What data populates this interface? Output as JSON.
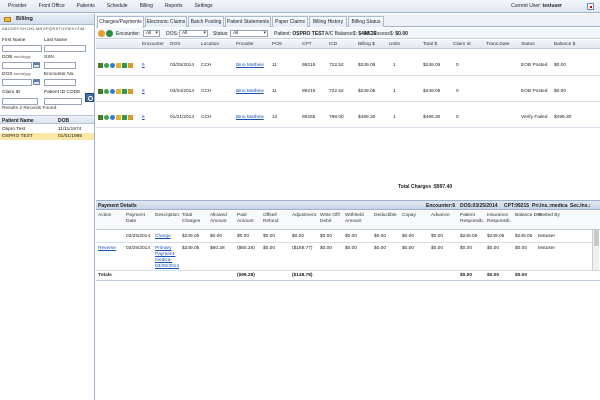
{
  "nav": {
    "items": [
      "Provider",
      "Front Office",
      "Patients",
      "Schedule",
      "Billing",
      "Reports",
      "Settings"
    ],
    "user_label": "Current User:",
    "user_name": "testuser"
  },
  "left": {
    "title": "Billing",
    "alphabet": [
      "A",
      "B",
      "C",
      "D",
      "E",
      "F",
      "G",
      "H",
      "I",
      "J",
      "K",
      "L",
      "M",
      "N",
      "O",
      "P",
      "Q",
      "R",
      "S",
      "T",
      "U",
      "V",
      "W",
      "X",
      "Y",
      "Z",
      "All"
    ],
    "first_name_label": "First Name",
    "last_name_label": "Last Name",
    "dob_label": "DOB",
    "date_hint": "mm/dd/yyyy",
    "ssn_label": "SSN",
    "dos_label": "DOS",
    "encounter_no_label": "Encounter No.",
    "claim_id_label": "Claim ID",
    "patient_id_label": "Patient ID",
    "code_label": "CODE",
    "results": "Results 2 Records Found.",
    "list_headers": [
      "Patient Name",
      "DOB"
    ],
    "patients": [
      {
        "name": "Ospro Test",
        "dob": "11/11/1974",
        "selected": false
      },
      {
        "name": "OSPRO TEST",
        "dob": "01/01/1985",
        "selected": true
      }
    ]
  },
  "tabs": [
    "Charges/Payments",
    "Electronic Claims",
    "Batch Posting",
    "Patient Statements",
    "Paper Claims",
    "Billing History",
    "Billing Status"
  ],
  "toolbar": {
    "encounter_label": "Encounter:",
    "encounter_value": "All",
    "dos_label": "DOS:",
    "dos_value": "All",
    "status_label": "Status:",
    "status_value": "All",
    "patient_label": "Patient:",
    "patient_value": "OSPRO TEST",
    "ac_balance_label": "A/C Balance$:",
    "ac_balance_value": "$499.30",
    "ac_excess_label": "A/C Excess$:",
    "ac_excess_value": "$0.00"
  },
  "grid": {
    "headers": [
      "Encounter",
      "DOS",
      "Location",
      "Provider",
      "POS",
      "CPT",
      "ICD",
      "Billing $",
      "Units",
      "Total $",
      "Claim Id",
      "Trans.Date",
      "Status",
      "Balance $"
    ],
    "rows": [
      {
        "encounter": "6",
        "dos": "03/25/2014",
        "location": "CCH",
        "provider": "Bino Mathew",
        "pos": "11",
        "cpt": "99215",
        "icd": "722.52",
        "billing": "$249.05",
        "units": "1",
        "total": "$249.05",
        "claim": "0",
        "trans": "",
        "status": "EOB Posted",
        "balance": "$0.00"
      },
      {
        "encounter": "6",
        "dos": "03/24/2014",
        "location": "CCH",
        "provider": "Bino Mathew",
        "pos": "11",
        "cpt": "99215",
        "icd": "722.52",
        "billing": "$249.05",
        "units": "1",
        "total": "$249.05",
        "claim": "0",
        "trans": "",
        "status": "EOB Posted",
        "balance": "$0.00"
      },
      {
        "encounter": "6",
        "dos": "01/21/2014",
        "location": "CCH",
        "provider": "Bino Mathew",
        "pos": "12",
        "cpt": "99255",
        "icd": "789.00",
        "billing": "$499.30",
        "units": "1",
        "total": "$499.30",
        "claim": "0",
        "trans": "",
        "status": "Verify Failed",
        "balance": "$499.30"
      }
    ],
    "total_charges": "Total Charges :$997.40"
  },
  "payment_details": {
    "title": "Payment Details",
    "encounter": "Encounter:6",
    "dos": "DOS:03/25/2014",
    "cpt": "CPT:99215",
    "pri": "Pri.Ins.:medica",
    "sec": "Sec.Ins.:",
    "headers": [
      "Action",
      "Payment Date",
      "Description",
      "Total Charges",
      "Allowed Amount",
      "Paid Amount",
      "Offset/ Refund",
      "Adjustment",
      "Write Off/ Debit",
      "Withheld Amount",
      "Deductible",
      "Copay",
      "Advance",
      "Patient Responsib.",
      "Insurance Responsib.",
      "Balance Due",
      "Posted By"
    ],
    "rows": [
      {
        "action": "",
        "date": "03/25/2014",
        "desc": "Charge",
        "total": "$249.05",
        "allowed": "$0.00",
        "paid": "$0.00",
        "offset": "$0.00",
        "adjust": "$0.00",
        "writeoff": "$0.00",
        "withheld": "$0.00",
        "deduct": "$0.00",
        "copay": "$0.00",
        "advance": "$0.00",
        "patresp": "$249.05",
        "insresp": "$249.05",
        "baldue": "$249.05",
        "postedby": "testuser"
      },
      {
        "action": "Reverse",
        "date": "03/25/2014",
        "desc": "Primary Payment- medica- 03/25/2014",
        "total": "$249.05",
        "allowed": "$60.28",
        "paid": "($60.28)",
        "offset": "$0.00",
        "adjust": "($188.77)",
        "writeoff": "$0.00",
        "withheld": "$0.00",
        "deduct": "$0.00",
        "copay": "$0.00",
        "advance": "$0.00",
        "patresp": "$0.00",
        "insresp": "$0.00",
        "baldue": "$0.00",
        "postedby": "testuser"
      }
    ],
    "totals_label": "Totals",
    "totals_paid": "($99.28)",
    "totals_adjust": "($148.78)",
    "totals_patresp": "$0.00",
    "totals_insresp": "$0.00",
    "totals_baldue": "$0.00"
  }
}
